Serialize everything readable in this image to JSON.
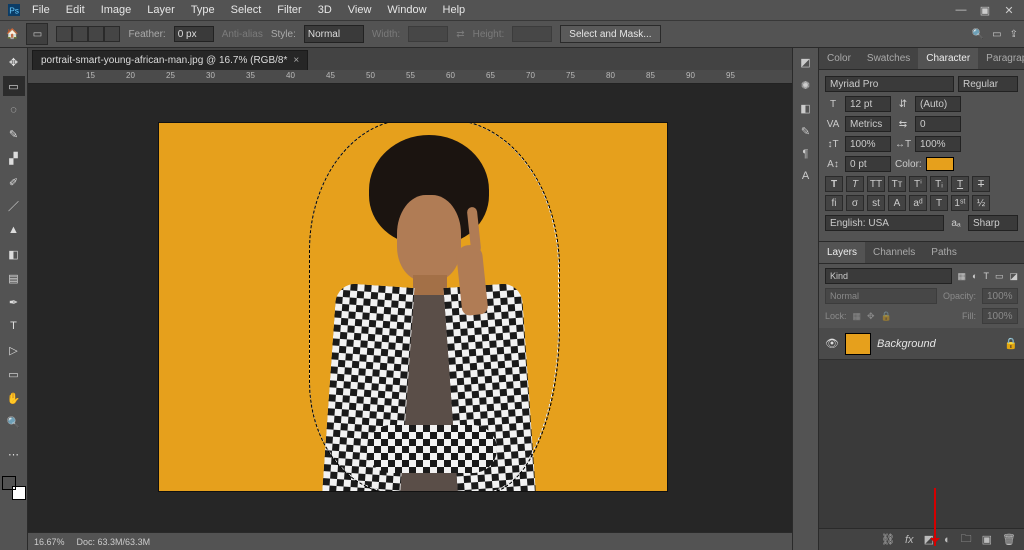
{
  "menu": {
    "items": [
      "File",
      "Edit",
      "Image",
      "Layer",
      "Type",
      "Select",
      "Filter",
      "3D",
      "View",
      "Window",
      "Help"
    ]
  },
  "options": {
    "feather_label": "Feather:",
    "feather_value": "0 px",
    "antialias": "Anti-alias",
    "style_label": "Style:",
    "style_value": "Normal",
    "width_label": "Width:",
    "height_label": "Height:",
    "select_mask": "Select and Mask..."
  },
  "document": {
    "tab": "portrait-smart-young-african-man.jpg @ 16.7% (RGB/8*",
    "zoom": "16.67%",
    "docsize": "Doc: 63.3M/63.3M"
  },
  "ruler": {
    "marks": [
      "15",
      "20",
      "25",
      "30",
      "35",
      "40",
      "45",
      "50",
      "55",
      "60",
      "65",
      "70",
      "75",
      "80",
      "85",
      "90",
      "95"
    ]
  },
  "swatch": {
    "fg": "#E6A01C"
  },
  "panels": {
    "top_tabs": [
      "Color",
      "Swatches",
      "Character",
      "Paragraph"
    ],
    "char": {
      "font": "Myriad Pro",
      "style": "Regular",
      "size": "12 pt",
      "leading": "(Auto)",
      "kerning": "Metrics",
      "tracking": "0",
      "vscale": "100%",
      "hscale": "100%",
      "baseline": "0 pt",
      "color_label": "Color:",
      "color": "#E6A01C",
      "lang": "English: USA",
      "aa": "Sharp"
    },
    "layers_tabs": [
      "Layers",
      "Channels",
      "Paths"
    ],
    "layers": {
      "kind": "Kind",
      "blend": "Normal",
      "opacity_label": "Opacity:",
      "opacity": "100%",
      "lock_label": "Lock:",
      "fill_label": "Fill:",
      "fill": "100%",
      "items": [
        {
          "name": "Background",
          "locked": true
        }
      ]
    }
  }
}
